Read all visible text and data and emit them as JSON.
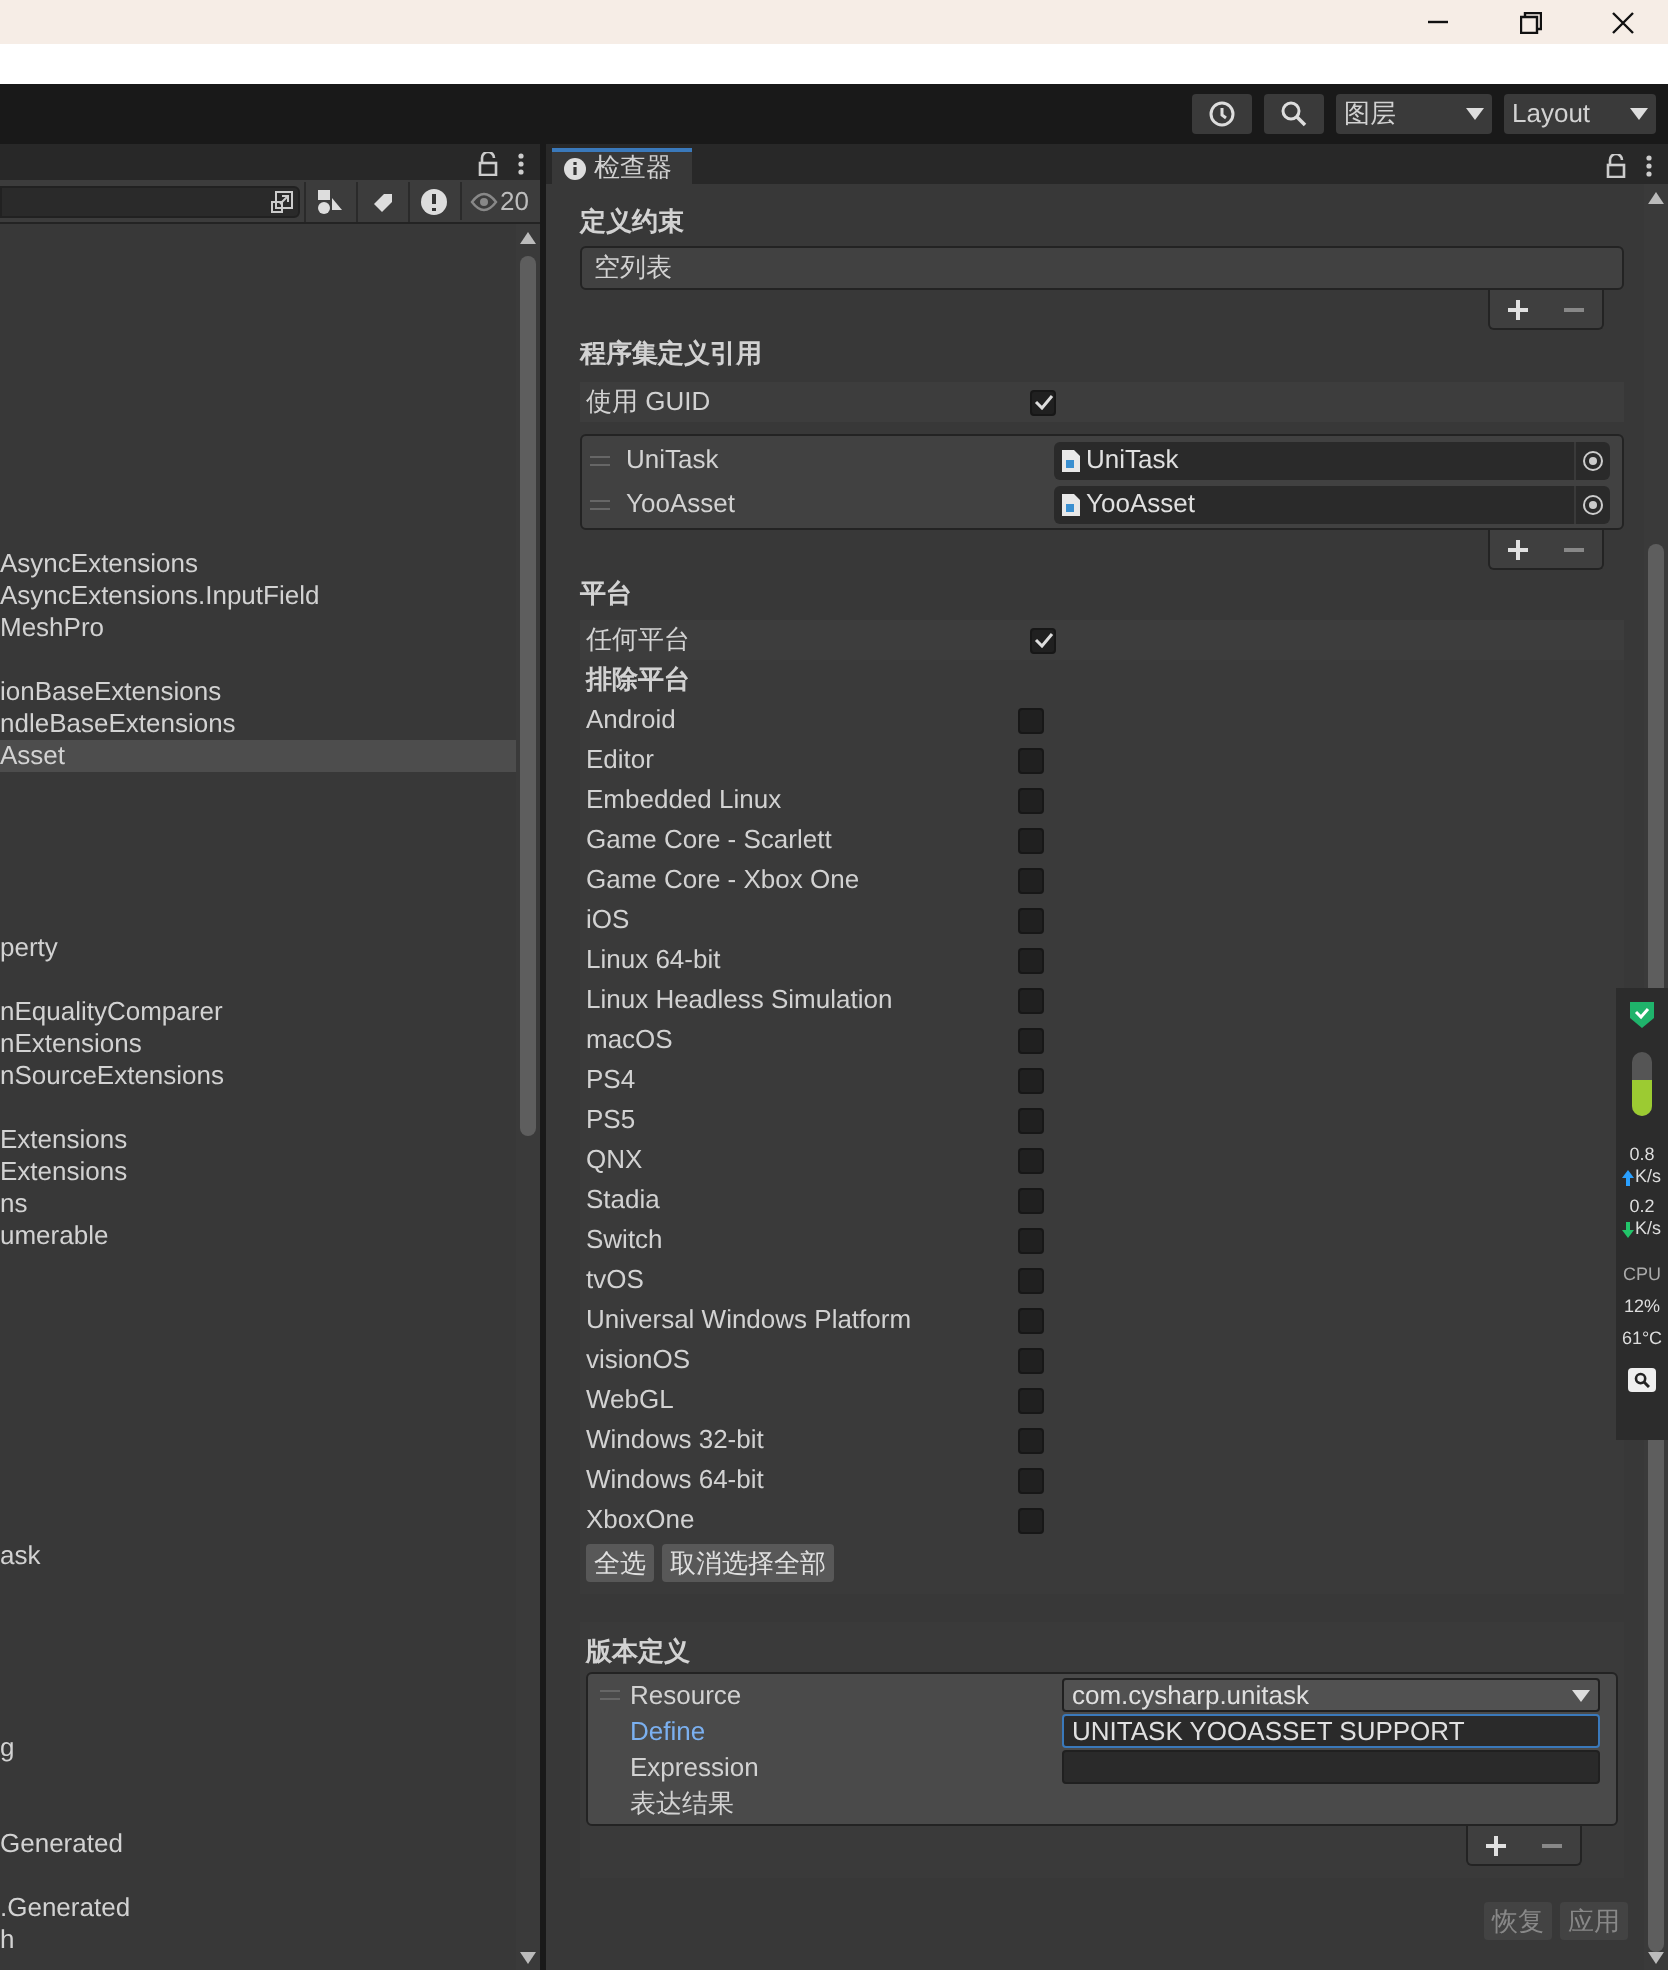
{
  "toolbar": {
    "layers_dropdown": "图层",
    "layout_dropdown": "Layout"
  },
  "hierarchy": {
    "visible_count": "20",
    "items": [
      {
        "text": "AsyncExtensions",
        "selected": false
      },
      {
        "text": "AsyncExtensions.InputField",
        "selected": false
      },
      {
        "text": "MeshPro",
        "selected": false
      },
      {
        "text": "ionBaseExtensions",
        "selected": false
      },
      {
        "text": "ndleBaseExtensions",
        "selected": false
      },
      {
        "text": "Asset",
        "selected": true
      },
      {
        "text": "perty",
        "selected": false
      },
      {
        "text": "nEqualityComparer",
        "selected": false
      },
      {
        "text": "nExtensions",
        "selected": false
      },
      {
        "text": "nSourceExtensions",
        "selected": false
      },
      {
        "text": "Extensions",
        "selected": false
      },
      {
        "text": "Extensions",
        "selected": false
      },
      {
        "text": "ns",
        "selected": false
      },
      {
        "text": "umerable",
        "selected": false
      },
      {
        "text": "ask",
        "selected": false
      },
      {
        "text": "g",
        "selected": false
      },
      {
        "text": "Generated",
        "selected": false
      },
      {
        "text": ".Generated",
        "selected": false
      },
      {
        "text": "h",
        "selected": false
      }
    ]
  },
  "inspector": {
    "tab": "检查器",
    "define_constraints": {
      "title": "定义约束",
      "empty_text": "空列表"
    },
    "assembly_references": {
      "title": "程序集定义引用",
      "use_guid": {
        "label": "使用 GUID",
        "checked": true
      },
      "items": [
        {
          "name": "UniTask",
          "value": "UniTask"
        },
        {
          "name": "YooAsset",
          "value": "YooAsset"
        }
      ]
    },
    "platforms": {
      "title": "平台",
      "any_platform": {
        "label": "任何平台",
        "checked": true
      },
      "exclude_title": "排除平台",
      "items": [
        {
          "label": "Android",
          "checked": false
        },
        {
          "label": "Editor",
          "checked": false
        },
        {
          "label": "Embedded Linux",
          "checked": false
        },
        {
          "label": "Game Core - Scarlett",
          "checked": false
        },
        {
          "label": "Game Core - Xbox One",
          "checked": false
        },
        {
          "label": "iOS",
          "checked": false
        },
        {
          "label": "Linux 64-bit",
          "checked": false
        },
        {
          "label": "Linux Headless Simulation",
          "checked": false
        },
        {
          "label": "macOS",
          "checked": false
        },
        {
          "label": "PS4",
          "checked": false
        },
        {
          "label": "PS5",
          "checked": false
        },
        {
          "label": "QNX",
          "checked": false
        },
        {
          "label": "Stadia",
          "checked": false
        },
        {
          "label": "Switch",
          "checked": false
        },
        {
          "label": "tvOS",
          "checked": false
        },
        {
          "label": "Universal Windows Platform",
          "checked": false
        },
        {
          "label": "visionOS",
          "checked": false
        },
        {
          "label": "WebGL",
          "checked": false
        },
        {
          "label": "Windows 32-bit",
          "checked": false
        },
        {
          "label": "Windows 64-bit",
          "checked": false
        },
        {
          "label": "XboxOne",
          "checked": false
        }
      ],
      "buttons": [
        "全选",
        "取消选择全部"
      ]
    },
    "version_defines": {
      "title": "版本定义",
      "fields": [
        {
          "label": "Resource",
          "kind": "dropdown",
          "value": "com.cysharp.unitask",
          "focused": false
        },
        {
          "label": "Define",
          "kind": "text",
          "value": "UNITASK YOOASSET SUPPORT",
          "focused": true
        },
        {
          "label": "Expression",
          "kind": "text",
          "focused": false
        },
        {
          "label": "表达结果",
          "kind": "label",
          "focused": false
        }
      ]
    },
    "footer_buttons": [
      "恢复",
      "应用"
    ]
  },
  "system_monitor": {
    "upload": "0.8",
    "upload_unit": "K/s",
    "download": "0.2",
    "download_unit": "K/s",
    "cpu_label": "CPU",
    "cpu_percent": "12%",
    "cpu_temp": "61°C"
  }
}
